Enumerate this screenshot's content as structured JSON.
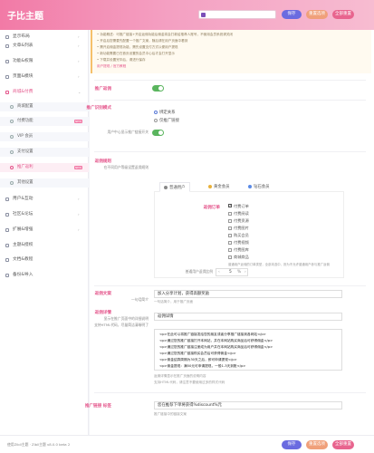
{
  "header": {
    "logo": "子比主题",
    "btn_save": "保存",
    "btn_reset": "重置选项",
    "btn_all": "全部重置",
    "colors": {
      "save": "#6a6be0",
      "reset": "#f0a07a",
      "all": "#e8648e"
    }
  },
  "sidebar": {
    "items": [
      {
        "label": "显示布局"
      },
      {
        "label": "文章&列表"
      },
      {
        "label": "功能&权限"
      },
      {
        "label": "页面&模块"
      },
      {
        "label": "商城&付费"
      },
      {
        "label": "用户&互动"
      }
    ],
    "subitems": [
      {
        "label": "商城配置"
      },
      {
        "label": "付费功能",
        "badge": "NEW"
      },
      {
        "label": "VIP 会员"
      },
      {
        "label": "支付设置"
      },
      {
        "label": "推广返利",
        "badge": "NEW"
      },
      {
        "label": "其他设置"
      }
    ],
    "bottom_items": [
      {
        "label": "社区&论坛"
      },
      {
        "label": "扩展&增强"
      },
      {
        "label": "主题&授权"
      },
      {
        "label": "文档&教程"
      },
      {
        "label": "备份&导入"
      }
    ]
  },
  "notice": {
    "lines": [
      "• 功能概述：可推广链接+开启返佣功能后佣金将会打款给推荐人账号，不使用会员系统请关闭",
      "• 开启后您需要先配置一个推广文案，随后请在用户页面中看到",
      "• 需开启佣金提现功能，需先设置支付方式以便用户提现",
      "• 新功能需要已在首页设置的会员中心后才会打开显示",
      "• 下载并设置完毕后，请进行保存",
      "• 用户提现 / 官方教程"
    ],
    "link": "用户提现 / 官方教程"
  },
  "form": {
    "enable_label": "推广返佣",
    "mode_label": "推广识别模式",
    "mode_options": [
      "绑定关系",
      "仅推广链接"
    ],
    "mode_help": "用户中心显示推广链接开关",
    "rules_label": "返佣规则",
    "rules_help": "在不同用户等级设置返佣规则",
    "tabs": [
      "普通用户",
      "黄金会员",
      "钻石会员"
    ],
    "order_label": "返佣订单",
    "order_types": [
      "付费订单",
      "付费阅读",
      "付费资源",
      "付费图片",
      "购买会员",
      "付费视频",
      "付费图库",
      "商城商品"
    ],
    "order_help": "普通用户返佣的订单类型，全部未选中，则为不允许普通用户参与推广返佣",
    "ratio_label": "普通用户返佣比例",
    "ratio_value": "5",
    "ratio_unit": "%",
    "title_label": "返佣文案",
    "title_sub": "一句话简介",
    "title_value": "加入分享计划，获得高额奖励",
    "title_help": "一句话简介，用于推广页面",
    "detail_label": "返佣详情",
    "detail_sub": "显示在推广页面中的详细说明",
    "detail_sub2": "支持HTML代码，尽量简洁清晰明了",
    "detail_title_value": "返佣详情",
    "detail_lines": [
      "<p>在此可以将推广链接发给您的朋友或者分享推广链接到各网站</p>",
      "<p>通过您的推广链接打开本网站，并在本网站购买商品后可获得佣金</p>",
      "<p>通过您的推广链接注册成为用户并在本网站购买商品后可获得佣金</p>",
      "<p>通过您的推广链接购买会员后可获得佣金</p>",
      "<p>佣金结算周期为30天之后，即可申请提现</p>",
      "<p>佣金提现：满50元可申请提现，一般1-3天到账</p>"
    ],
    "detail_help": "返佣详情显示在推广页面的说明内容",
    "detail_help2": "支持HTML代码，请注意不要使用过多的样式代码",
    "share_label": "推广链接 标签",
    "share_value": "您在推荐下单将获得%discount%元",
    "share_help": "推广链接中的链接文案"
  },
  "footer": {
    "text": "使用Zibll主题 · Zibll主题 v8.0.0 beta 2",
    "btn_save": "保存",
    "btn_reset": "重置选项",
    "btn_all": "全部重置"
  }
}
